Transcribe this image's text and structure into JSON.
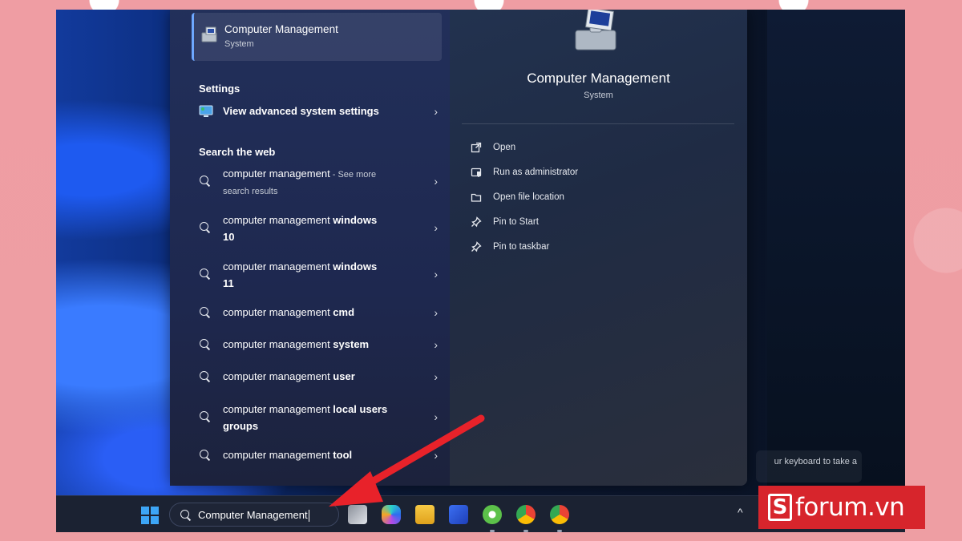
{
  "best_match": {
    "title": "Computer Management",
    "subtitle": "System"
  },
  "sections": {
    "settings": "Settings",
    "web": "Search the web"
  },
  "settings_items": [
    {
      "label": "View advanced system settings"
    }
  ],
  "web_results": [
    {
      "prefix": "computer management",
      "bold": "",
      "suffix": " - See more",
      "line2": "search results"
    },
    {
      "prefix": "computer management ",
      "bold": "windows",
      "suffix": "",
      "line2": "10"
    },
    {
      "prefix": "computer management ",
      "bold": "windows",
      "suffix": "",
      "line2": "11"
    },
    {
      "prefix": "computer management ",
      "bold": "cmd",
      "suffix": "",
      "line2": ""
    },
    {
      "prefix": "computer management ",
      "bold": "system",
      "suffix": "",
      "line2": ""
    },
    {
      "prefix": "computer management ",
      "bold": "user",
      "suffix": "",
      "line2": ""
    },
    {
      "prefix": "computer management ",
      "bold": "local users",
      "suffix": "",
      "line2": "groups"
    },
    {
      "prefix": "computer management ",
      "bold": "tool",
      "suffix": "",
      "line2": ""
    }
  ],
  "detail": {
    "title": "Computer Management",
    "subtitle": "System",
    "actions": [
      {
        "label": "Open",
        "icon": "open-external-icon"
      },
      {
        "label": "Run as administrator",
        "icon": "shield-admin-icon"
      },
      {
        "label": "Open file location",
        "icon": "folder-icon"
      },
      {
        "label": "Pin to Start",
        "icon": "pin-icon"
      },
      {
        "label": "Pin to taskbar",
        "icon": "pin-icon"
      }
    ]
  },
  "toast_text": "ur keyboard to take a",
  "taskbar": {
    "search_value": "Computer Management"
  },
  "watermark": {
    "s": "S",
    "text": "forum.vn"
  },
  "colors": {
    "accent": "#6ea8ff",
    "arrow": "#e8222a",
    "brand": "#d7252c"
  }
}
